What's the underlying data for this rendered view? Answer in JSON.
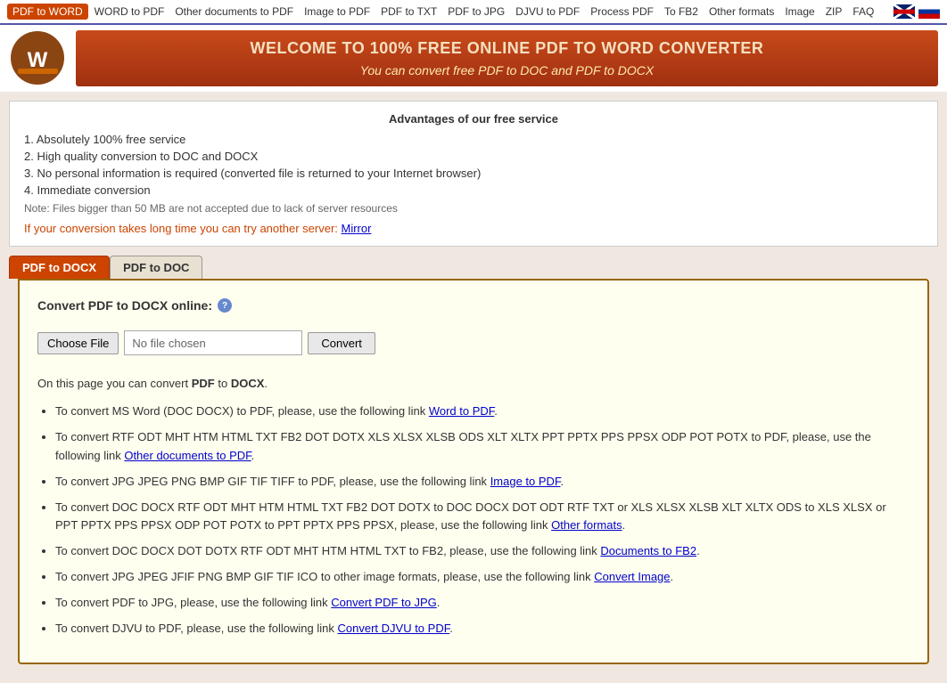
{
  "navbar": {
    "links": [
      {
        "label": "WORD to PDF",
        "active": false
      },
      {
        "label": "Other documents to PDF",
        "active": false
      },
      {
        "label": "Image to PDF",
        "active": false
      },
      {
        "label": "PDF to TXT",
        "active": false
      },
      {
        "label": "PDF to WORD",
        "active": true
      },
      {
        "label": "PDF to JPG",
        "active": false
      },
      {
        "label": "DJVU to PDF",
        "active": false
      },
      {
        "label": "Process PDF",
        "active": false
      },
      {
        "label": "To FB2",
        "active": false
      },
      {
        "label": "Other formats",
        "active": false
      },
      {
        "label": "Image",
        "active": false
      },
      {
        "label": "ZIP",
        "active": false
      },
      {
        "label": "FAQ",
        "active": false
      }
    ]
  },
  "header": {
    "title": "WELCOME TO 100% FREE ONLINE PDF TO WORD CONVERTER",
    "subtitle": "You can convert free PDF to DOC and PDF to DOCX"
  },
  "advantages": {
    "heading": "Advantages of our free service",
    "items": [
      "1. Absolutely 100% free service",
      "2. High quality conversion to DOC and DOCX",
      "3. No personal information is required (converted file is returned to your Internet browser)",
      "4. Immediate conversion"
    ],
    "note": "Note: Files bigger than 50 MB are not accepted due to lack of server resources",
    "mirror_text": "If your conversion takes long time you can try another server:",
    "mirror_link_label": "Mirror"
  },
  "tabs": [
    {
      "label": "PDF to DOCX",
      "active": true
    },
    {
      "label": "PDF to DOC",
      "active": false
    }
  ],
  "panel": {
    "convert_label": "Convert PDF to DOCX online:",
    "choose_file_btn": "Choose File",
    "file_placeholder": "No file chosen",
    "convert_btn": "Convert",
    "description_intro": "On this page you can convert",
    "description_from": "PDF",
    "description_to": "DOCX",
    "description_end": ".",
    "bullets": [
      {
        "text": "To convert MS Word (DOC DOCX) to PDF, please, use the following link",
        "link_label": "Word to PDF",
        "text_after": "."
      },
      {
        "text": "To convert RTF ODT MHT HTM HTML TXT FB2 DOT DOTX XLS XLSX XLSB ODS XLT XLTX PPT PPTX PPS PPSX ODP POT POTX to PDF, please, use the following link",
        "link_label": "Other documents to PDF",
        "text_after": "."
      },
      {
        "text": "To convert JPG JPEG PNG BMP GIF TIF TIFF to PDF, please, use the following link",
        "link_label": "Image to PDF",
        "text_after": "."
      },
      {
        "text": "To convert DOC DOCX RTF ODT MHT HTM HTML TXT FB2 DOT DOTX to DOC DOCX DOT ODT RTF TXT or XLS XLSX XLSB XLT XLTX ODS to XLS XLSX or PPT PPTX PPS PPSX ODP POT POTX to PPT PPTX PPS PPSX, please, use the following link",
        "link_label": "Other formats",
        "text_after": "."
      },
      {
        "text": "To convert DOC DOCX DOT DOTX RTF ODT MHT HTM HTML TXT to FB2, please, use the following link",
        "link_label": "Documents to FB2",
        "text_after": "."
      },
      {
        "text": "To convert JPG JPEG JFIF PNG BMP GIF TIF ICO to other image formats, please, use the following link",
        "link_label": "Convert Image",
        "text_after": "."
      },
      {
        "text": "To convert PDF to JPG, please, use the following link",
        "link_label": "Convert PDF to JPG",
        "text_after": "."
      },
      {
        "text": "To convert DJVU to PDF, please, use the following link",
        "link_label": "Convert DJVU to PDF",
        "text_after": "."
      }
    ]
  }
}
